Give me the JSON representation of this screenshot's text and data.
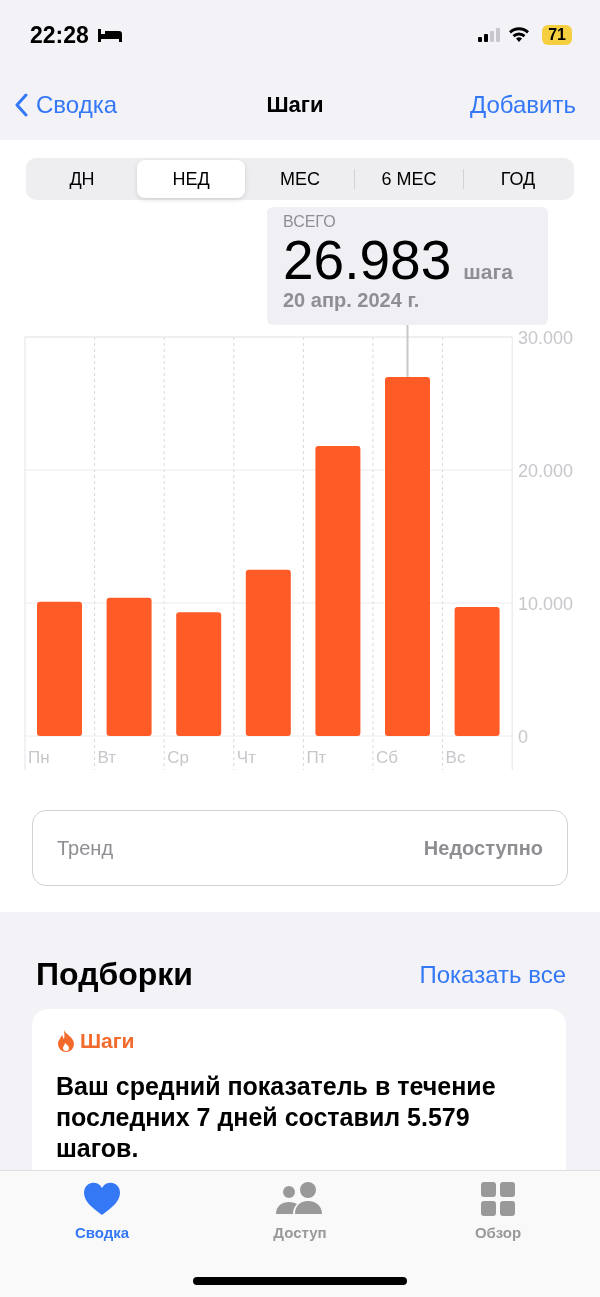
{
  "status_bar": {
    "time": "22:28",
    "battery": "71"
  },
  "nav": {
    "back": "Сводка",
    "title": "Шаги",
    "action": "Добавить"
  },
  "segments": [
    {
      "label": "ДН",
      "selected": false
    },
    {
      "label": "НЕД",
      "selected": true
    },
    {
      "label": "МЕС",
      "selected": false
    },
    {
      "label": "6 МЕС",
      "selected": false
    },
    {
      "label": "ГОД",
      "selected": false
    }
  ],
  "tooltip": {
    "label": "ВСЕГО",
    "value": "26.983",
    "unit": "шага",
    "date": "20 апр. 2024 г."
  },
  "chart_data": {
    "type": "bar",
    "categories": [
      "Пн",
      "Вт",
      "Ср",
      "Чт",
      "Пт",
      "Сб",
      "Вс"
    ],
    "series": [
      {
        "color": "#ff5b26",
        "values": [
          10100,
          10400,
          9300,
          12500,
          21800,
          27000,
          9700
        ]
      }
    ],
    "ylim": [
      0,
      30000
    ],
    "yticks": [
      {
        "value": 0,
        "label": "0"
      },
      {
        "value": 10000,
        "label": "10.000"
      },
      {
        "value": 20000,
        "label": "20.000"
      },
      {
        "value": 30000,
        "label": "30.000"
      }
    ]
  },
  "trend": {
    "label": "Тренд",
    "value": "Недоступно"
  },
  "highlights": {
    "title": "Подборки",
    "link": "Показать все",
    "card": {
      "category": "Шаги",
      "text": "Ваш средний показатель в течение последних 7 дней составил 5.579 шагов."
    }
  },
  "tab_bar": [
    {
      "label": "Сводка",
      "selected": true
    },
    {
      "label": "Доступ",
      "selected": false
    },
    {
      "label": "Обзор",
      "selected": false
    }
  ]
}
